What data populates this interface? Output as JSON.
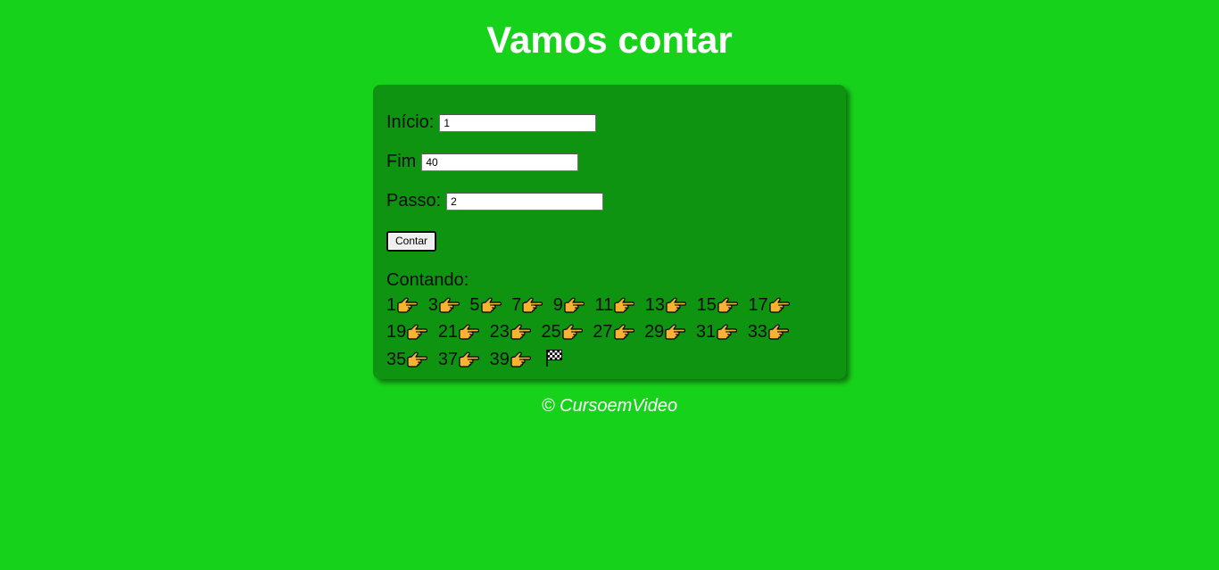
{
  "header": {
    "title": "Vamos contar"
  },
  "form": {
    "start_label": "Início:",
    "start_value": "1",
    "end_label": "Fim",
    "end_value": "40",
    "step_label": "Passo:",
    "step_value": "2",
    "button_label": "Contar"
  },
  "result": {
    "label": "Contando:",
    "numbers": [
      "1",
      "3",
      "5",
      "7",
      "9",
      "11",
      "13",
      "15",
      "17",
      "19",
      "21",
      "23",
      "25",
      "27",
      "29",
      "31",
      "33",
      "35",
      "37",
      "39"
    ],
    "separator_icon": "pointing-hand-icon",
    "end_icon": "checkered-flag-icon"
  },
  "footer": {
    "text": "© CursoemVideo"
  },
  "colors": {
    "background": "#17d21a",
    "card": "#0f9412",
    "hand_fill": "#f9b233"
  }
}
